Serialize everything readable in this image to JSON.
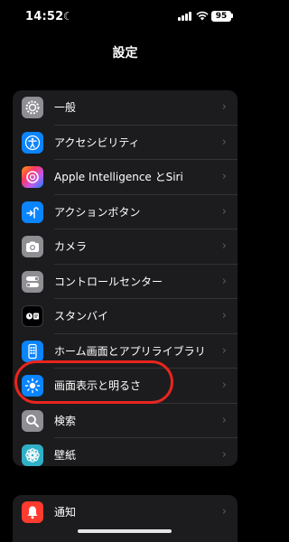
{
  "status_bar": {
    "time": "14:52",
    "battery": "95"
  },
  "header": {
    "title": "設定"
  },
  "settings": {
    "items": [
      {
        "label": "一般",
        "icon": "gear-icon",
        "color": "#8e8e93"
      },
      {
        "label": "アクセシビリティ",
        "icon": "accessibility-icon",
        "color": "#0a84ff"
      },
      {
        "label": "Apple Intelligence とSiri",
        "icon": "siri-icon",
        "color": "#bf5af2"
      },
      {
        "label": "アクションボタン",
        "icon": "action-button-icon",
        "color": "#0a84ff"
      },
      {
        "label": "カメラ",
        "icon": "camera-icon",
        "color": "#8e8e93"
      },
      {
        "label": "コントロールセンター",
        "icon": "toggles-icon",
        "color": "#8e8e93"
      },
      {
        "label": "スタンバイ",
        "icon": "standby-icon",
        "color": "#1c1c1e"
      },
      {
        "label": "ホーム画面とアプリライブラリ",
        "icon": "home-screen-icon",
        "color": "#0a84ff"
      },
      {
        "label": "画面表示と明るさ",
        "icon": "brightness-icon",
        "color": "#0a84ff"
      },
      {
        "label": "検索",
        "icon": "search-icon",
        "color": "#8e8e93"
      },
      {
        "label": "壁紙",
        "icon": "wallpaper-icon",
        "color": "#30b0c7"
      }
    ]
  },
  "settings2": {
    "items": [
      {
        "label": "通知",
        "icon": "bell-icon",
        "color": "#ff3b30"
      }
    ]
  },
  "annotation_color": "#e8251e"
}
